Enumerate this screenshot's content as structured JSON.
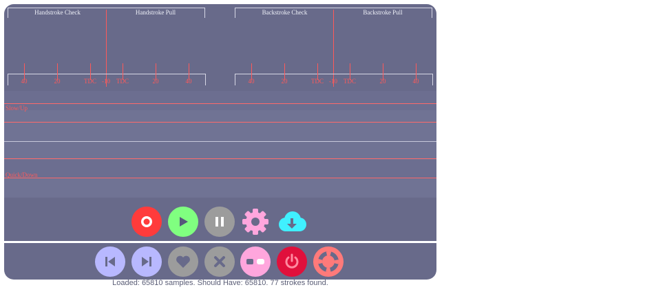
{
  "colors": {
    "panel_bg": "#686a8a",
    "tick_red": "#ff5a5a",
    "scale_line": "#d7d8e6",
    "record": "#ff3b3b",
    "play": "#80ff80",
    "gray": "#9c9c9c",
    "pink": "#ffa6dd",
    "cyan": "#40f0ff",
    "lavender": "#b8b8ff",
    "power_red": "#e0103c",
    "salmon": "#ff7a7a"
  },
  "gauges": {
    "handstroke": {
      "check_label": "Handstroke Check",
      "pull_label": "Handstroke Pull",
      "ticks": [
        "40",
        "20",
        "TDC",
        "-10",
        "TDC",
        "20",
        "40"
      ]
    },
    "backstroke": {
      "check_label": "Backstroke Check",
      "pull_label": "Backstroke Pull",
      "ticks": [
        "40",
        "20",
        "TDC",
        "-10",
        "TDC",
        "20",
        "40"
      ]
    }
  },
  "traces": {
    "slow_label": "Slow/Up",
    "quick_label": "Quick/Down"
  },
  "toolbar_top": [
    {
      "name": "record-button",
      "icon": "record-icon"
    },
    {
      "name": "play-button",
      "icon": "play-icon"
    },
    {
      "name": "pause-button",
      "icon": "pause-icon"
    },
    {
      "name": "settings-button",
      "icon": "gear-icon"
    },
    {
      "name": "download-button",
      "icon": "cloud-download-icon"
    }
  ],
  "toolbar_bottom": [
    {
      "name": "previous-button",
      "icon": "skip-back-icon"
    },
    {
      "name": "next-button",
      "icon": "skip-forward-icon"
    },
    {
      "name": "favorite-button",
      "icon": "heart-icon"
    },
    {
      "name": "delete-button",
      "icon": "close-icon"
    },
    {
      "name": "toggle-button",
      "icon": "toggle-icon"
    },
    {
      "name": "power-button",
      "icon": "power-icon"
    },
    {
      "name": "help-button",
      "icon": "lifebuoy-icon"
    }
  ],
  "status": {
    "text": "Loaded: 65810 samples. Should Have: 65810. 77 strokes found."
  }
}
